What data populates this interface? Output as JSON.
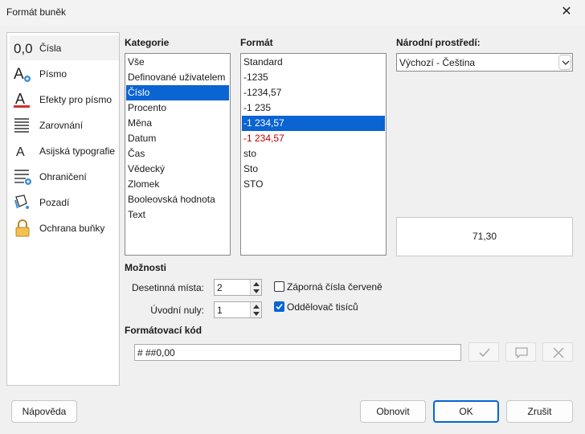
{
  "window": {
    "title": "Formát buněk",
    "close_glyph": "✕"
  },
  "sidebar": {
    "items": [
      {
        "label": "Čísla",
        "icon": "numbers-icon"
      },
      {
        "label": "Písmo",
        "icon": "font-icon"
      },
      {
        "label": "Efekty pro písmo",
        "icon": "font-effects-icon"
      },
      {
        "label": "Zarovnání",
        "icon": "alignment-icon"
      },
      {
        "label": "Asijská typografie",
        "icon": "asian-typography-icon"
      },
      {
        "label": "Ohraničení",
        "icon": "borders-icon"
      },
      {
        "label": "Pozadí",
        "icon": "background-icon"
      },
      {
        "label": "Ochrana buňky",
        "icon": "lock-icon"
      }
    ],
    "active_index": 0
  },
  "category": {
    "heading": "Kategorie",
    "items": [
      "Vše",
      "Definované uživatelem",
      "Číslo",
      "Procento",
      "Měna",
      "Datum",
      "Čas",
      "Vědecký",
      "Zlomek",
      "Booleovská hodnota",
      "Text"
    ],
    "selected_index": 2
  },
  "format": {
    "heading": "Formát",
    "items": [
      "Standard",
      "-1235",
      "-1234,57",
      "-1 235",
      "-1 234,57",
      "-1 234,57",
      "sto",
      "Sto",
      "STO"
    ],
    "selected_index": 4,
    "negative_red_indices": [
      5
    ]
  },
  "locale": {
    "heading": "Národní prostředí:",
    "value": "Výchozí - Čeština"
  },
  "preview": {
    "value": "71,30"
  },
  "options": {
    "heading": "Možnosti",
    "decimal_places_label": "Desetinná místa:",
    "decimal_places_value": "2",
    "leading_zeros_label": "Úvodní nuly:",
    "leading_zeros_value": "1",
    "negative_red_label": "Záporná čísla červeně",
    "negative_red_checked": false,
    "thousands_sep_label": "Oddělovač tisíců",
    "thousands_sep_checked": true
  },
  "format_code": {
    "heading": "Formátovací kód",
    "value": "# ##0,00"
  },
  "buttons": {
    "help": "Nápověda",
    "reset": "Obnovit",
    "ok": "OK",
    "cancel": "Zrušit"
  },
  "colors": {
    "accent": "#0a64d2",
    "negative_red": "#c00000"
  }
}
